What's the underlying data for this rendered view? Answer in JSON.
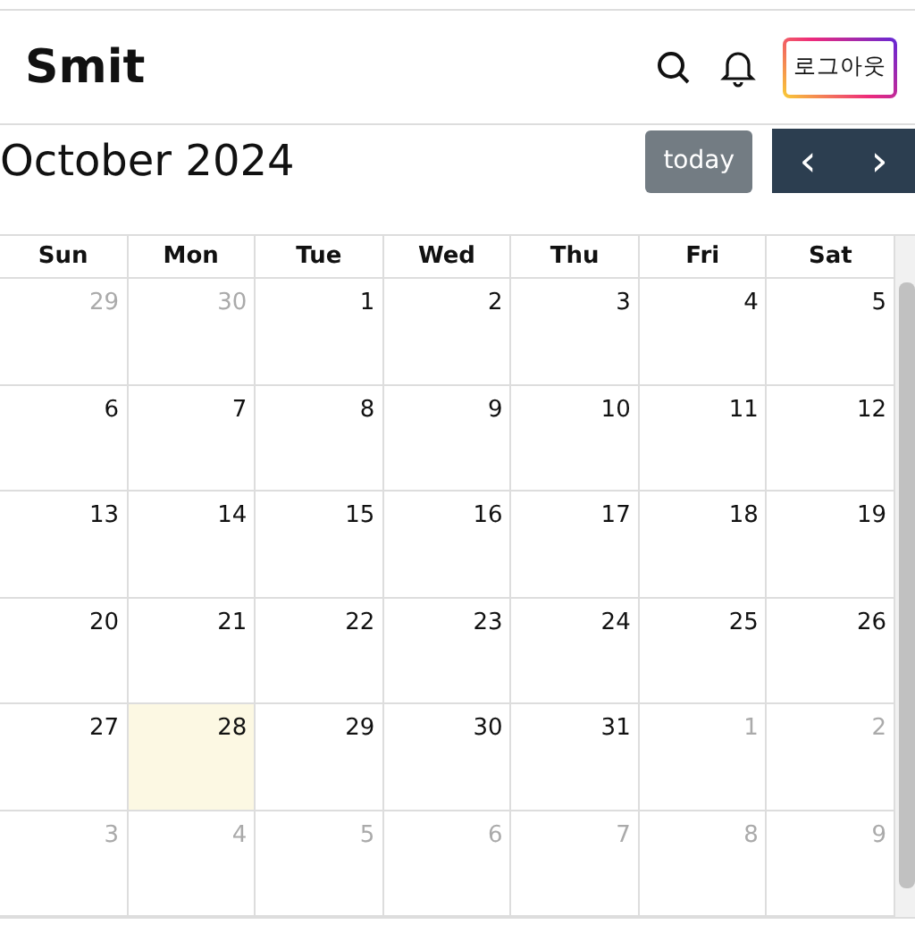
{
  "header": {
    "logo": "Smit",
    "logout_button": "로그아웃"
  },
  "toolbar": {
    "title": "October 2024",
    "today_button": "today",
    "prev_button": "‹",
    "next_button": "›"
  },
  "calendar": {
    "weekdays": [
      "Sun",
      "Mon",
      "Tue",
      "Wed",
      "Thu",
      "Fri",
      "Sat"
    ],
    "weeks": [
      [
        {
          "day": "29",
          "other_month": true,
          "today": false
        },
        {
          "day": "30",
          "other_month": true,
          "today": false
        },
        {
          "day": "1",
          "other_month": false,
          "today": false
        },
        {
          "day": "2",
          "other_month": false,
          "today": false
        },
        {
          "day": "3",
          "other_month": false,
          "today": false
        },
        {
          "day": "4",
          "other_month": false,
          "today": false
        },
        {
          "day": "5",
          "other_month": false,
          "today": false
        }
      ],
      [
        {
          "day": "6",
          "other_month": false,
          "today": false
        },
        {
          "day": "7",
          "other_month": false,
          "today": false
        },
        {
          "day": "8",
          "other_month": false,
          "today": false
        },
        {
          "day": "9",
          "other_month": false,
          "today": false
        },
        {
          "day": "10",
          "other_month": false,
          "today": false
        },
        {
          "day": "11",
          "other_month": false,
          "today": false
        },
        {
          "day": "12",
          "other_month": false,
          "today": false
        }
      ],
      [
        {
          "day": "13",
          "other_month": false,
          "today": false
        },
        {
          "day": "14",
          "other_month": false,
          "today": false
        },
        {
          "day": "15",
          "other_month": false,
          "today": false
        },
        {
          "day": "16",
          "other_month": false,
          "today": false
        },
        {
          "day": "17",
          "other_month": false,
          "today": false
        },
        {
          "day": "18",
          "other_month": false,
          "today": false
        },
        {
          "day": "19",
          "other_month": false,
          "today": false
        }
      ],
      [
        {
          "day": "20",
          "other_month": false,
          "today": false
        },
        {
          "day": "21",
          "other_month": false,
          "today": false
        },
        {
          "day": "22",
          "other_month": false,
          "today": false
        },
        {
          "day": "23",
          "other_month": false,
          "today": false
        },
        {
          "day": "24",
          "other_month": false,
          "today": false
        },
        {
          "day": "25",
          "other_month": false,
          "today": false
        },
        {
          "day": "26",
          "other_month": false,
          "today": false
        }
      ],
      [
        {
          "day": "27",
          "other_month": false,
          "today": false
        },
        {
          "day": "28",
          "other_month": false,
          "today": true
        },
        {
          "day": "29",
          "other_month": false,
          "today": false
        },
        {
          "day": "30",
          "other_month": false,
          "today": false
        },
        {
          "day": "31",
          "other_month": false,
          "today": false
        },
        {
          "day": "1",
          "other_month": true,
          "today": false
        },
        {
          "day": "2",
          "other_month": true,
          "today": false
        }
      ],
      [
        {
          "day": "3",
          "other_month": true,
          "today": false
        },
        {
          "day": "4",
          "other_month": true,
          "today": false
        },
        {
          "day": "5",
          "other_month": true,
          "today": false
        },
        {
          "day": "6",
          "other_month": true,
          "today": false
        },
        {
          "day": "7",
          "other_month": true,
          "today": false
        },
        {
          "day": "8",
          "other_month": true,
          "today": false
        },
        {
          "day": "9",
          "other_month": true,
          "today": false
        }
      ]
    ]
  }
}
